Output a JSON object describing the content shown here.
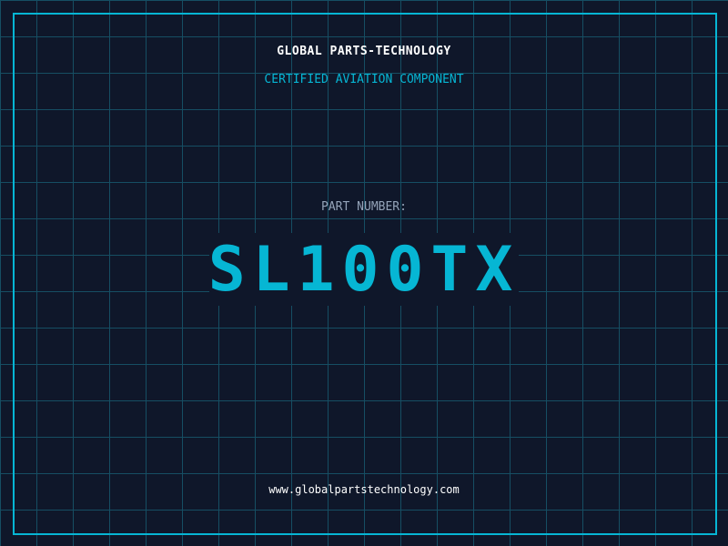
{
  "header": {
    "title": "GLOBAL PARTS-TECHNOLOGY",
    "subtitle": "CERTIFIED AVIATION COMPONENT"
  },
  "part": {
    "label": "PART NUMBER:",
    "number": "SL100TX"
  },
  "footer": {
    "url": "www.globalpartstechnology.com"
  },
  "colors": {
    "background": "#0f172a",
    "accent": "#06b6d4",
    "grid": "#164e63"
  }
}
